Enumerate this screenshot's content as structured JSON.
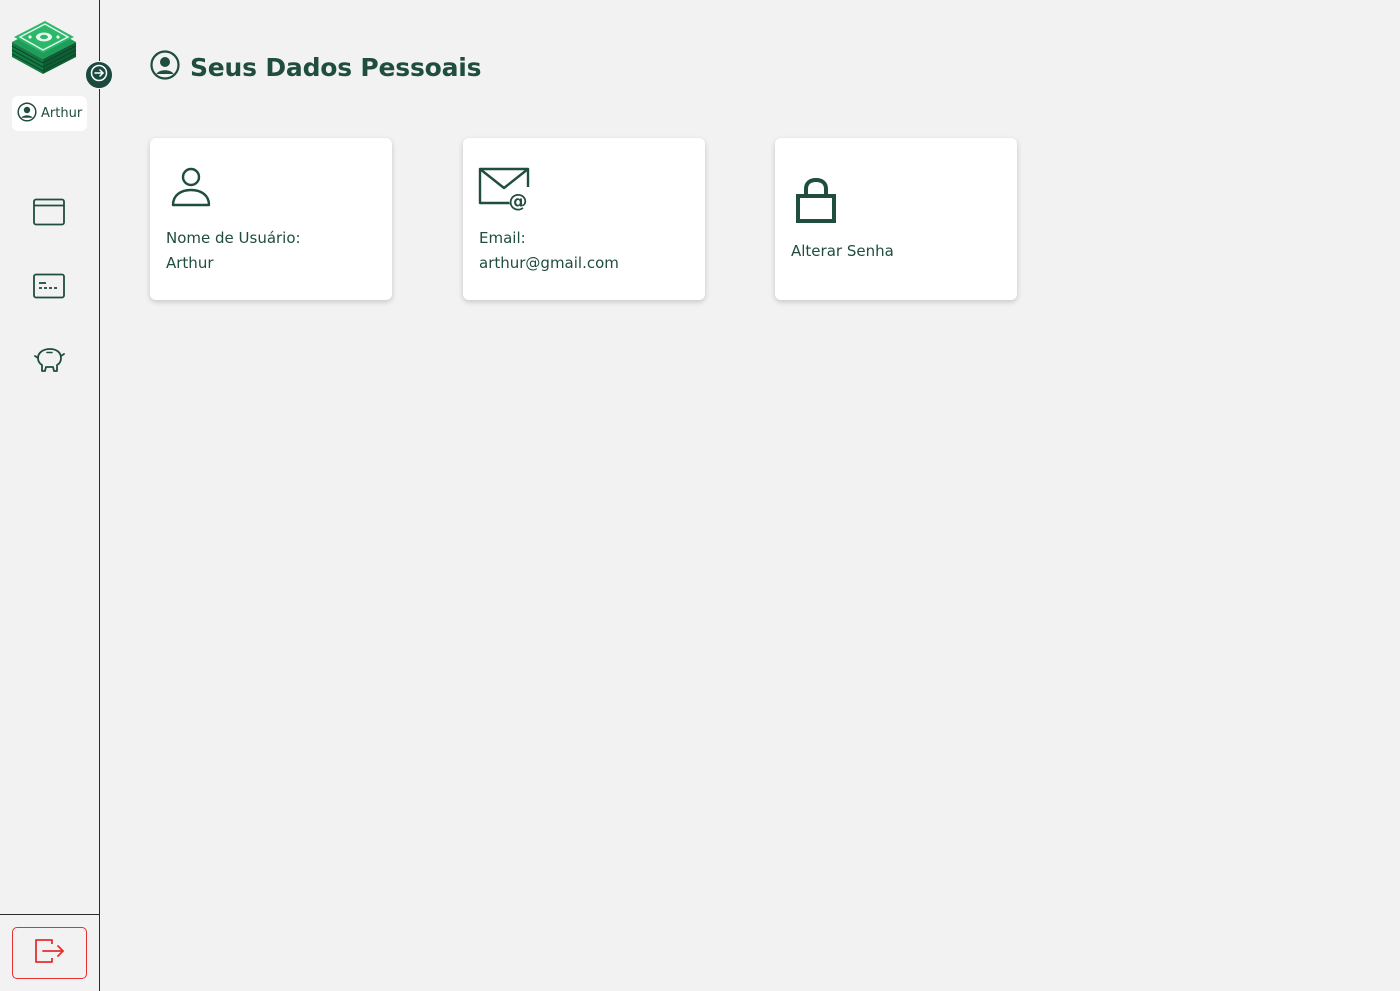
{
  "sidebar": {
    "user_chip": {
      "name": "Arthur"
    },
    "nav_items": [
      {
        "icon": "window-icon"
      },
      {
        "icon": "card-icon"
      },
      {
        "icon": "piggy-bank-icon"
      }
    ],
    "logout": {
      "icon": "logout-icon"
    }
  },
  "header": {
    "title": "Seus Dados Pessoais",
    "icon": "user-circle-icon"
  },
  "cards": [
    {
      "label": "Nome de Usuário:",
      "value": "Arthur",
      "icon": "user-icon"
    },
    {
      "label": "Email:",
      "value": "arthur@gmail.com",
      "icon": "mail-at-icon"
    },
    {
      "label": "Alterar Senha",
      "icon": "lock-icon"
    }
  ],
  "colors": {
    "primary": "#1f4d3e",
    "background": "#f2f2f2",
    "card": "#ffffff",
    "danger": "#e5312f",
    "logo_green": "#1e9e5a"
  }
}
